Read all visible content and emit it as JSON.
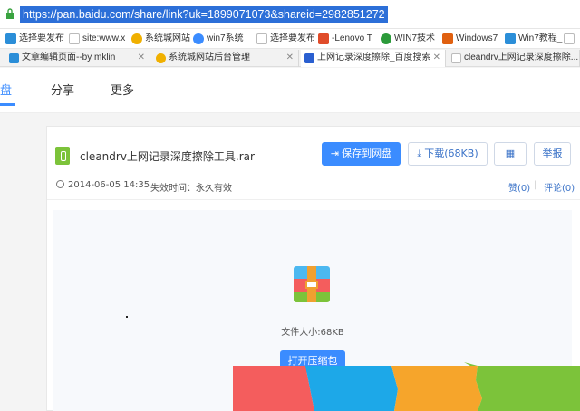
{
  "address_bar": {
    "url": "https://pan.baidu.com/share/link?uk=1899071073&shareid=2982851272"
  },
  "bookmarks": [
    {
      "label": "选择要发布",
      "icon": "blue-square-icon",
      "color": "#2b8ed8"
    },
    {
      "label": "site:www.x",
      "icon": "page-icon",
      "color": "#cccccc"
    },
    {
      "label": "系统城网站",
      "icon": "globe-icon",
      "color": "#f0b000"
    },
    {
      "label": "win7系统",
      "icon": "cloud-icon",
      "color": "#3b8cff"
    },
    {
      "label": "选择要发布",
      "icon": "page-icon",
      "color": "#cccccc"
    },
    {
      "label": "-Lenovo T",
      "icon": "lenovo-icon",
      "color": "#e04c2a"
    },
    {
      "label": "WIN7技术",
      "icon": "leaf-icon",
      "color": "#2b9a3a"
    },
    {
      "label": "Windows7",
      "icon": "pencil-icon",
      "color": "#e06010"
    },
    {
      "label": "Win7教程_",
      "icon": "windows-icon",
      "color": "#2b8ed8"
    }
  ],
  "tabs": [
    {
      "label": "文章编辑页面--by mklin",
      "icon": "blue-square-icon",
      "color": "#2b8ed8"
    },
    {
      "label": "系统城网站后台管理",
      "icon": "globe-icon",
      "color": "#f0b000"
    },
    {
      "label": "上网记录深度擦除_百度搜索",
      "icon": "paw-icon",
      "color": "#2a5fd0"
    },
    {
      "label": "cleandrv上网记录深度擦除...",
      "icon": "page-icon",
      "color": "#cccccc"
    }
  ],
  "site_nav": {
    "items": [
      {
        "label": "盘",
        "active": true
      },
      {
        "label": "分享",
        "active": false
      },
      {
        "label": "更多",
        "active": false
      }
    ]
  },
  "file": {
    "name": "cleandrv上网记录深度擦除工具.rar",
    "save_label": "保存到网盘",
    "download_label": "下载(68KB)",
    "report_label": "举报",
    "date": "2014-06-05 14:35",
    "expiry": "失效时间：永久有效",
    "like_label": "赞(0)",
    "comment_label": "评论(0)",
    "size_text": "文件大小:68KB",
    "open_label": "打开压缩包"
  },
  "colors": {
    "accent": "#3b8cff",
    "overlay": [
      "#f45d5d",
      "#1da8e8",
      "#f6a52b",
      "#7cc33a"
    ]
  }
}
